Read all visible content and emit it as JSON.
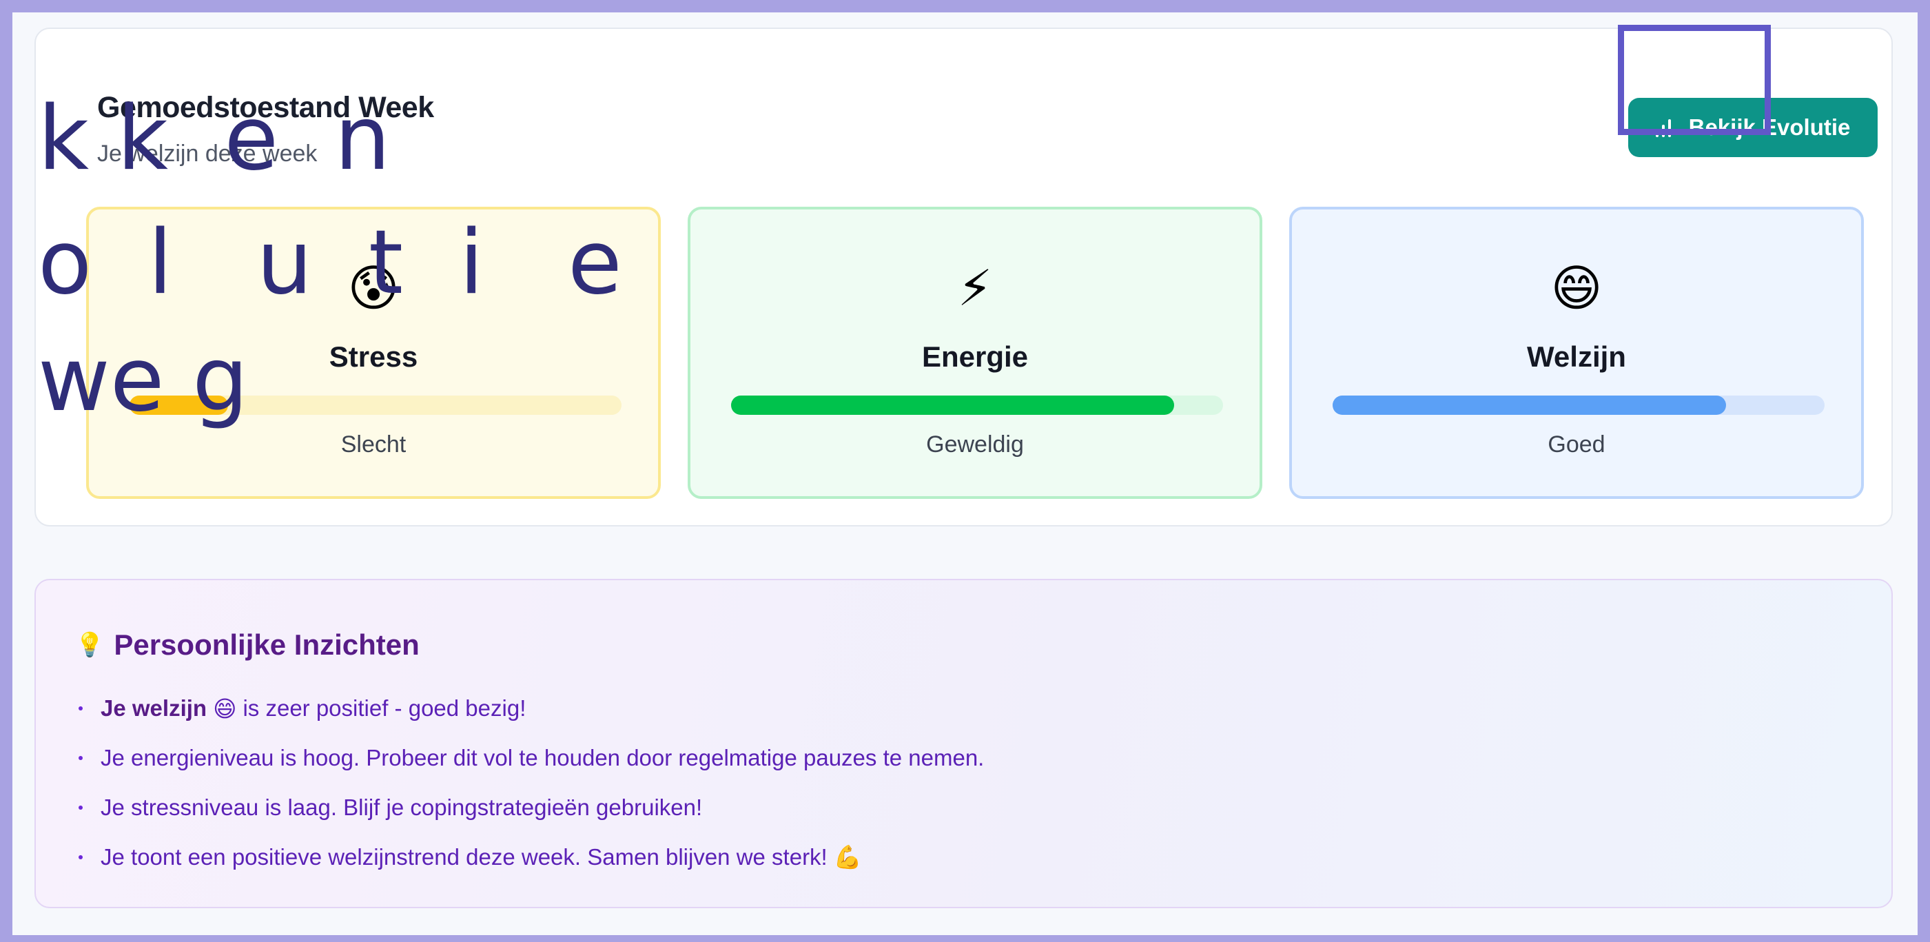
{
  "card": {
    "title": "Gemoedstoestand Week",
    "subtitle": "Je welzijn deze week"
  },
  "evolution_button": {
    "label": "Bekijk Evolutie",
    "icon": "bar-chart-icon"
  },
  "metrics": [
    {
      "emoji": "😰",
      "icon": "anxious-face-icon",
      "label": "Stress",
      "level": "Slecht",
      "value_fraction": 0.2,
      "color": "#fbbf0f"
    },
    {
      "emoji": "⚡",
      "icon": "lightning-icon",
      "label": "Energie",
      "level": "Geweldig",
      "value_fraction": 0.9,
      "color": "#00c24c"
    },
    {
      "emoji": "😄",
      "icon": "grinning-face-icon",
      "label": "Welzijn",
      "level": "Goed",
      "value_fraction": 0.8,
      "color": "#5ba0f6"
    }
  ],
  "overlay_text": {
    "line1": "k k  e  n",
    "line2": "o  l   u  t  i   e",
    "line3": "we g"
  },
  "insights": {
    "icon": "lightbulb-icon",
    "bulb": "💡",
    "title": "Persoonlijke Inzichten",
    "items": [
      {
        "bold": "Je welzijn",
        "emoji": "😄",
        "text": "is zeer positief - goed bezig!"
      },
      {
        "text": "Je energieniveau is hoog. Probeer dit vol te houden door regelmatige pauzes te nemen."
      },
      {
        "text": "Je stressniveau is laag. Blijf je copingstrategieën gebruiken!"
      },
      {
        "text": "Je toont een positieve welzijnstrend deze week. Samen blijven we sterk! 💪"
      }
    ]
  },
  "colors": {
    "accent": "#0d9488",
    "insight_text": "#5b21b6",
    "highlight_box": "#6058c8"
  }
}
